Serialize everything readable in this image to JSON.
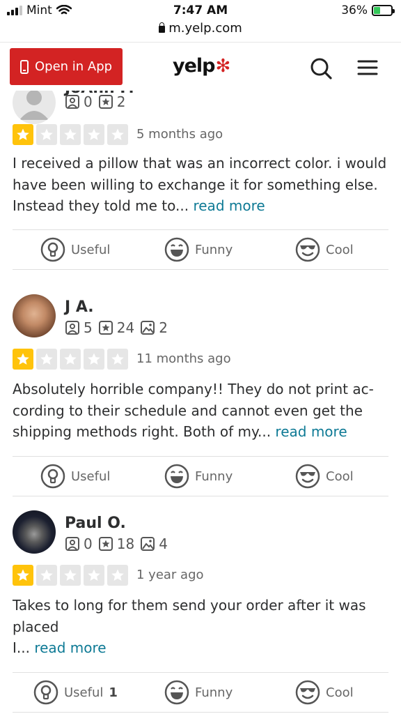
{
  "status_bar": {
    "carrier": "Mint",
    "time": "7:47 AM",
    "battery": "36%",
    "url": "m.yelp.com"
  },
  "header": {
    "open_app_label": "Open in App",
    "logo_text": "yelp"
  },
  "read_more_label": "read more",
  "reviews": [
    {
      "name": "JoAnn P.",
      "stats": {
        "reviews": "0",
        "friends": "2"
      },
      "rating": 1,
      "date": "5 months ago",
      "text": "I received a pillow that was an incorrect color. i would have been willing to exchange it for something else. Instead they told me to...",
      "actions": {
        "useful": "Useful",
        "useful_count": "",
        "funny": "Funny",
        "cool": "Cool"
      }
    },
    {
      "name": "J A.",
      "stats": {
        "reviews": "5",
        "friends": "24",
        "photos": "2"
      },
      "rating": 1,
      "date": "11 months ago",
      "text": "Absolutely horrible company!! They do not print ac-cording to their schedule and cannot even get the shipping methods right. Both of my...",
      "actions": {
        "useful": "Useful",
        "useful_count": "",
        "funny": "Funny",
        "cool": "Cool"
      }
    },
    {
      "name": "Paul O.",
      "stats": {
        "reviews": "0",
        "friends": "18",
        "photos": "4"
      },
      "rating": 1,
      "date": "1 year ago",
      "text": "Takes to long for them send your order after it was placed\nI...",
      "actions": {
        "useful": "Useful",
        "useful_count": "1",
        "funny": "Funny",
        "cool": "Cool"
      }
    }
  ],
  "colors": {
    "brand_red": "#d32323",
    "star_yellow": "#ffc30b",
    "link_teal": "#0e7a95"
  },
  "icons": [
    "wifi-icon",
    "lock-icon",
    "battery-icon",
    "phone-icon",
    "search-icon",
    "menu-icon",
    "review-count-icon",
    "friend-star-icon",
    "photo-icon",
    "star-icon",
    "useful-bulb-icon",
    "funny-face-icon",
    "cool-face-icon"
  ]
}
